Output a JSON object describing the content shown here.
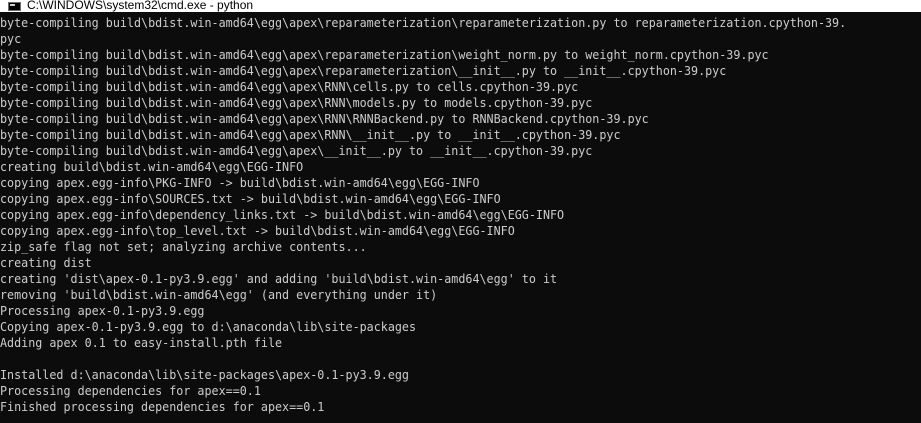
{
  "window": {
    "title": "C:\\WINDOWS\\system32\\cmd.exe - python",
    "text_color": "#cccccc",
    "background_color": "#0c0c0c",
    "icon": "cmd-icon"
  },
  "console": {
    "lines": [
      "byte-compiling build\\bdist.win-amd64\\egg\\apex\\reparameterization\\reparameterization.py to reparameterization.cpython-39.",
      "pyc",
      "byte-compiling build\\bdist.win-amd64\\egg\\apex\\reparameterization\\weight_norm.py to weight_norm.cpython-39.pyc",
      "byte-compiling build\\bdist.win-amd64\\egg\\apex\\reparameterization\\__init__.py to __init__.cpython-39.pyc",
      "byte-compiling build\\bdist.win-amd64\\egg\\apex\\RNN\\cells.py to cells.cpython-39.pyc",
      "byte-compiling build\\bdist.win-amd64\\egg\\apex\\RNN\\models.py to models.cpython-39.pyc",
      "byte-compiling build\\bdist.win-amd64\\egg\\apex\\RNN\\RNNBackend.py to RNNBackend.cpython-39.pyc",
      "byte-compiling build\\bdist.win-amd64\\egg\\apex\\RNN\\__init__.py to __init__.cpython-39.pyc",
      "byte-compiling build\\bdist.win-amd64\\egg\\apex\\__init__.py to __init__.cpython-39.pyc",
      "creating build\\bdist.win-amd64\\egg\\EGG-INFO",
      "copying apex.egg-info\\PKG-INFO -> build\\bdist.win-amd64\\egg\\EGG-INFO",
      "copying apex.egg-info\\SOURCES.txt -> build\\bdist.win-amd64\\egg\\EGG-INFO",
      "copying apex.egg-info\\dependency_links.txt -> build\\bdist.win-amd64\\egg\\EGG-INFO",
      "copying apex.egg-info\\top_level.txt -> build\\bdist.win-amd64\\egg\\EGG-INFO",
      "zip_safe flag not set; analyzing archive contents...",
      "creating dist",
      "creating 'dist\\apex-0.1-py3.9.egg' and adding 'build\\bdist.win-amd64\\egg' to it",
      "removing 'build\\bdist.win-amd64\\egg' (and everything under it)",
      "Processing apex-0.1-py3.9.egg",
      "Copying apex-0.1-py3.9.egg to d:\\anaconda\\lib\\site-packages",
      "Adding apex 0.1 to easy-install.pth file",
      "",
      "Installed d:\\anaconda\\lib\\site-packages\\apex-0.1-py3.9.egg",
      "Processing dependencies for apex==0.1",
      "Finished processing dependencies for apex==0.1"
    ]
  }
}
